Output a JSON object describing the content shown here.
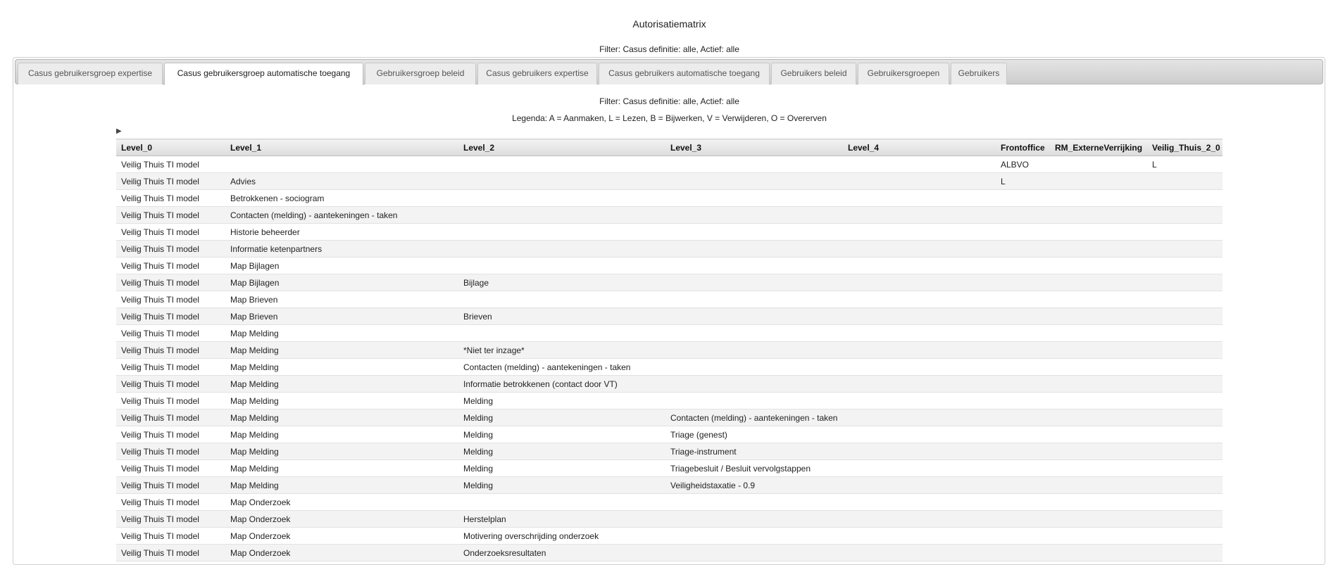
{
  "header": {
    "title": "Autorisatiematrix",
    "filter": "Filter: Casus definitie: alle, Actief: alle"
  },
  "tabs": [
    {
      "label": "Casus gebruikersgroep expertise",
      "active": false
    },
    {
      "label": "Casus gebruikersgroep automatische toegang",
      "active": true
    },
    {
      "label": "Gebruikersgroep beleid",
      "active": false
    },
    {
      "label": "Casus gebruikers expertise",
      "active": false
    },
    {
      "label": "Casus gebruikers automatische toegang",
      "active": false
    },
    {
      "label": "Gebruikers beleid",
      "active": false
    },
    {
      "label": "Gebruikersgroepen",
      "active": false
    },
    {
      "label": "Gebruikers",
      "active": false
    }
  ],
  "panel": {
    "filter": "Filter: Casus definitie: alle, Actief: alle",
    "legend": "Legenda: A = Aanmaken, L = Lezen, B = Bijwerken, V = Verwijderen, O = Overerven",
    "toggle_icon": "triangle-right-icon"
  },
  "table": {
    "columns": [
      "Level_0",
      "Level_1",
      "Level_2",
      "Level_3",
      "Level_4",
      "Frontoffice",
      "RM_ExterneVerrijking",
      "Veilig_Thuis_2_0"
    ],
    "rows": [
      [
        "Veilig Thuis TI model",
        "",
        "",
        "",
        "",
        "ALBVO",
        "",
        "L"
      ],
      [
        "Veilig Thuis TI model",
        "Advies",
        "",
        "",
        "",
        "L",
        "",
        ""
      ],
      [
        "Veilig Thuis TI model",
        "Betrokkenen - sociogram",
        "",
        "",
        "",
        "",
        "",
        ""
      ],
      [
        "Veilig Thuis TI model",
        "Contacten (melding) - aantekeningen - taken",
        "",
        "",
        "",
        "",
        "",
        ""
      ],
      [
        "Veilig Thuis TI model",
        "Historie beheerder",
        "",
        "",
        "",
        "",
        "",
        ""
      ],
      [
        "Veilig Thuis TI model",
        "Informatie ketenpartners",
        "",
        "",
        "",
        "",
        "",
        ""
      ],
      [
        "Veilig Thuis TI model",
        "Map Bijlagen",
        "",
        "",
        "",
        "",
        "",
        ""
      ],
      [
        "Veilig Thuis TI model",
        "Map Bijlagen",
        "Bijlage",
        "",
        "",
        "",
        "",
        ""
      ],
      [
        "Veilig Thuis TI model",
        "Map Brieven",
        "",
        "",
        "",
        "",
        "",
        ""
      ],
      [
        "Veilig Thuis TI model",
        "Map Brieven",
        "Brieven",
        "",
        "",
        "",
        "",
        ""
      ],
      [
        "Veilig Thuis TI model",
        "Map Melding",
        "",
        "",
        "",
        "",
        "",
        ""
      ],
      [
        "Veilig Thuis TI model",
        "Map Melding",
        "*Niet ter inzage*",
        "",
        "",
        "",
        "",
        ""
      ],
      [
        "Veilig Thuis TI model",
        "Map Melding",
        "Contacten (melding) - aantekeningen - taken",
        "",
        "",
        "",
        "",
        ""
      ],
      [
        "Veilig Thuis TI model",
        "Map Melding",
        "Informatie betrokkenen (contact door VT)",
        "",
        "",
        "",
        "",
        ""
      ],
      [
        "Veilig Thuis TI model",
        "Map Melding",
        "Melding",
        "",
        "",
        "",
        "",
        ""
      ],
      [
        "Veilig Thuis TI model",
        "Map Melding",
        "Melding",
        "Contacten (melding) - aantekeningen - taken",
        "",
        "",
        "",
        ""
      ],
      [
        "Veilig Thuis TI model",
        "Map Melding",
        "Melding",
        "Triage (genest)",
        "",
        "",
        "",
        ""
      ],
      [
        "Veilig Thuis TI model",
        "Map Melding",
        "Melding",
        "Triage-instrument",
        "",
        "",
        "",
        ""
      ],
      [
        "Veilig Thuis TI model",
        "Map Melding",
        "Melding",
        "Triagebesluit / Besluit vervolgstappen",
        "",
        "",
        "",
        ""
      ],
      [
        "Veilig Thuis TI model",
        "Map Melding",
        "Melding",
        "Veiligheidstaxatie - 0.9",
        "",
        "",
        "",
        ""
      ],
      [
        "Veilig Thuis TI model",
        "Map Onderzoek",
        "",
        "",
        "",
        "",
        "",
        ""
      ],
      [
        "Veilig Thuis TI model",
        "Map Onderzoek",
        "Herstelplan",
        "",
        "",
        "",
        "",
        ""
      ],
      [
        "Veilig Thuis TI model",
        "Map Onderzoek",
        "Motivering overschrijding onderzoek",
        "",
        "",
        "",
        "",
        ""
      ],
      [
        "Veilig Thuis TI model",
        "Map Onderzoek",
        "Onderzoeksresultaten",
        "",
        "",
        "",
        "",
        ""
      ]
    ]
  }
}
